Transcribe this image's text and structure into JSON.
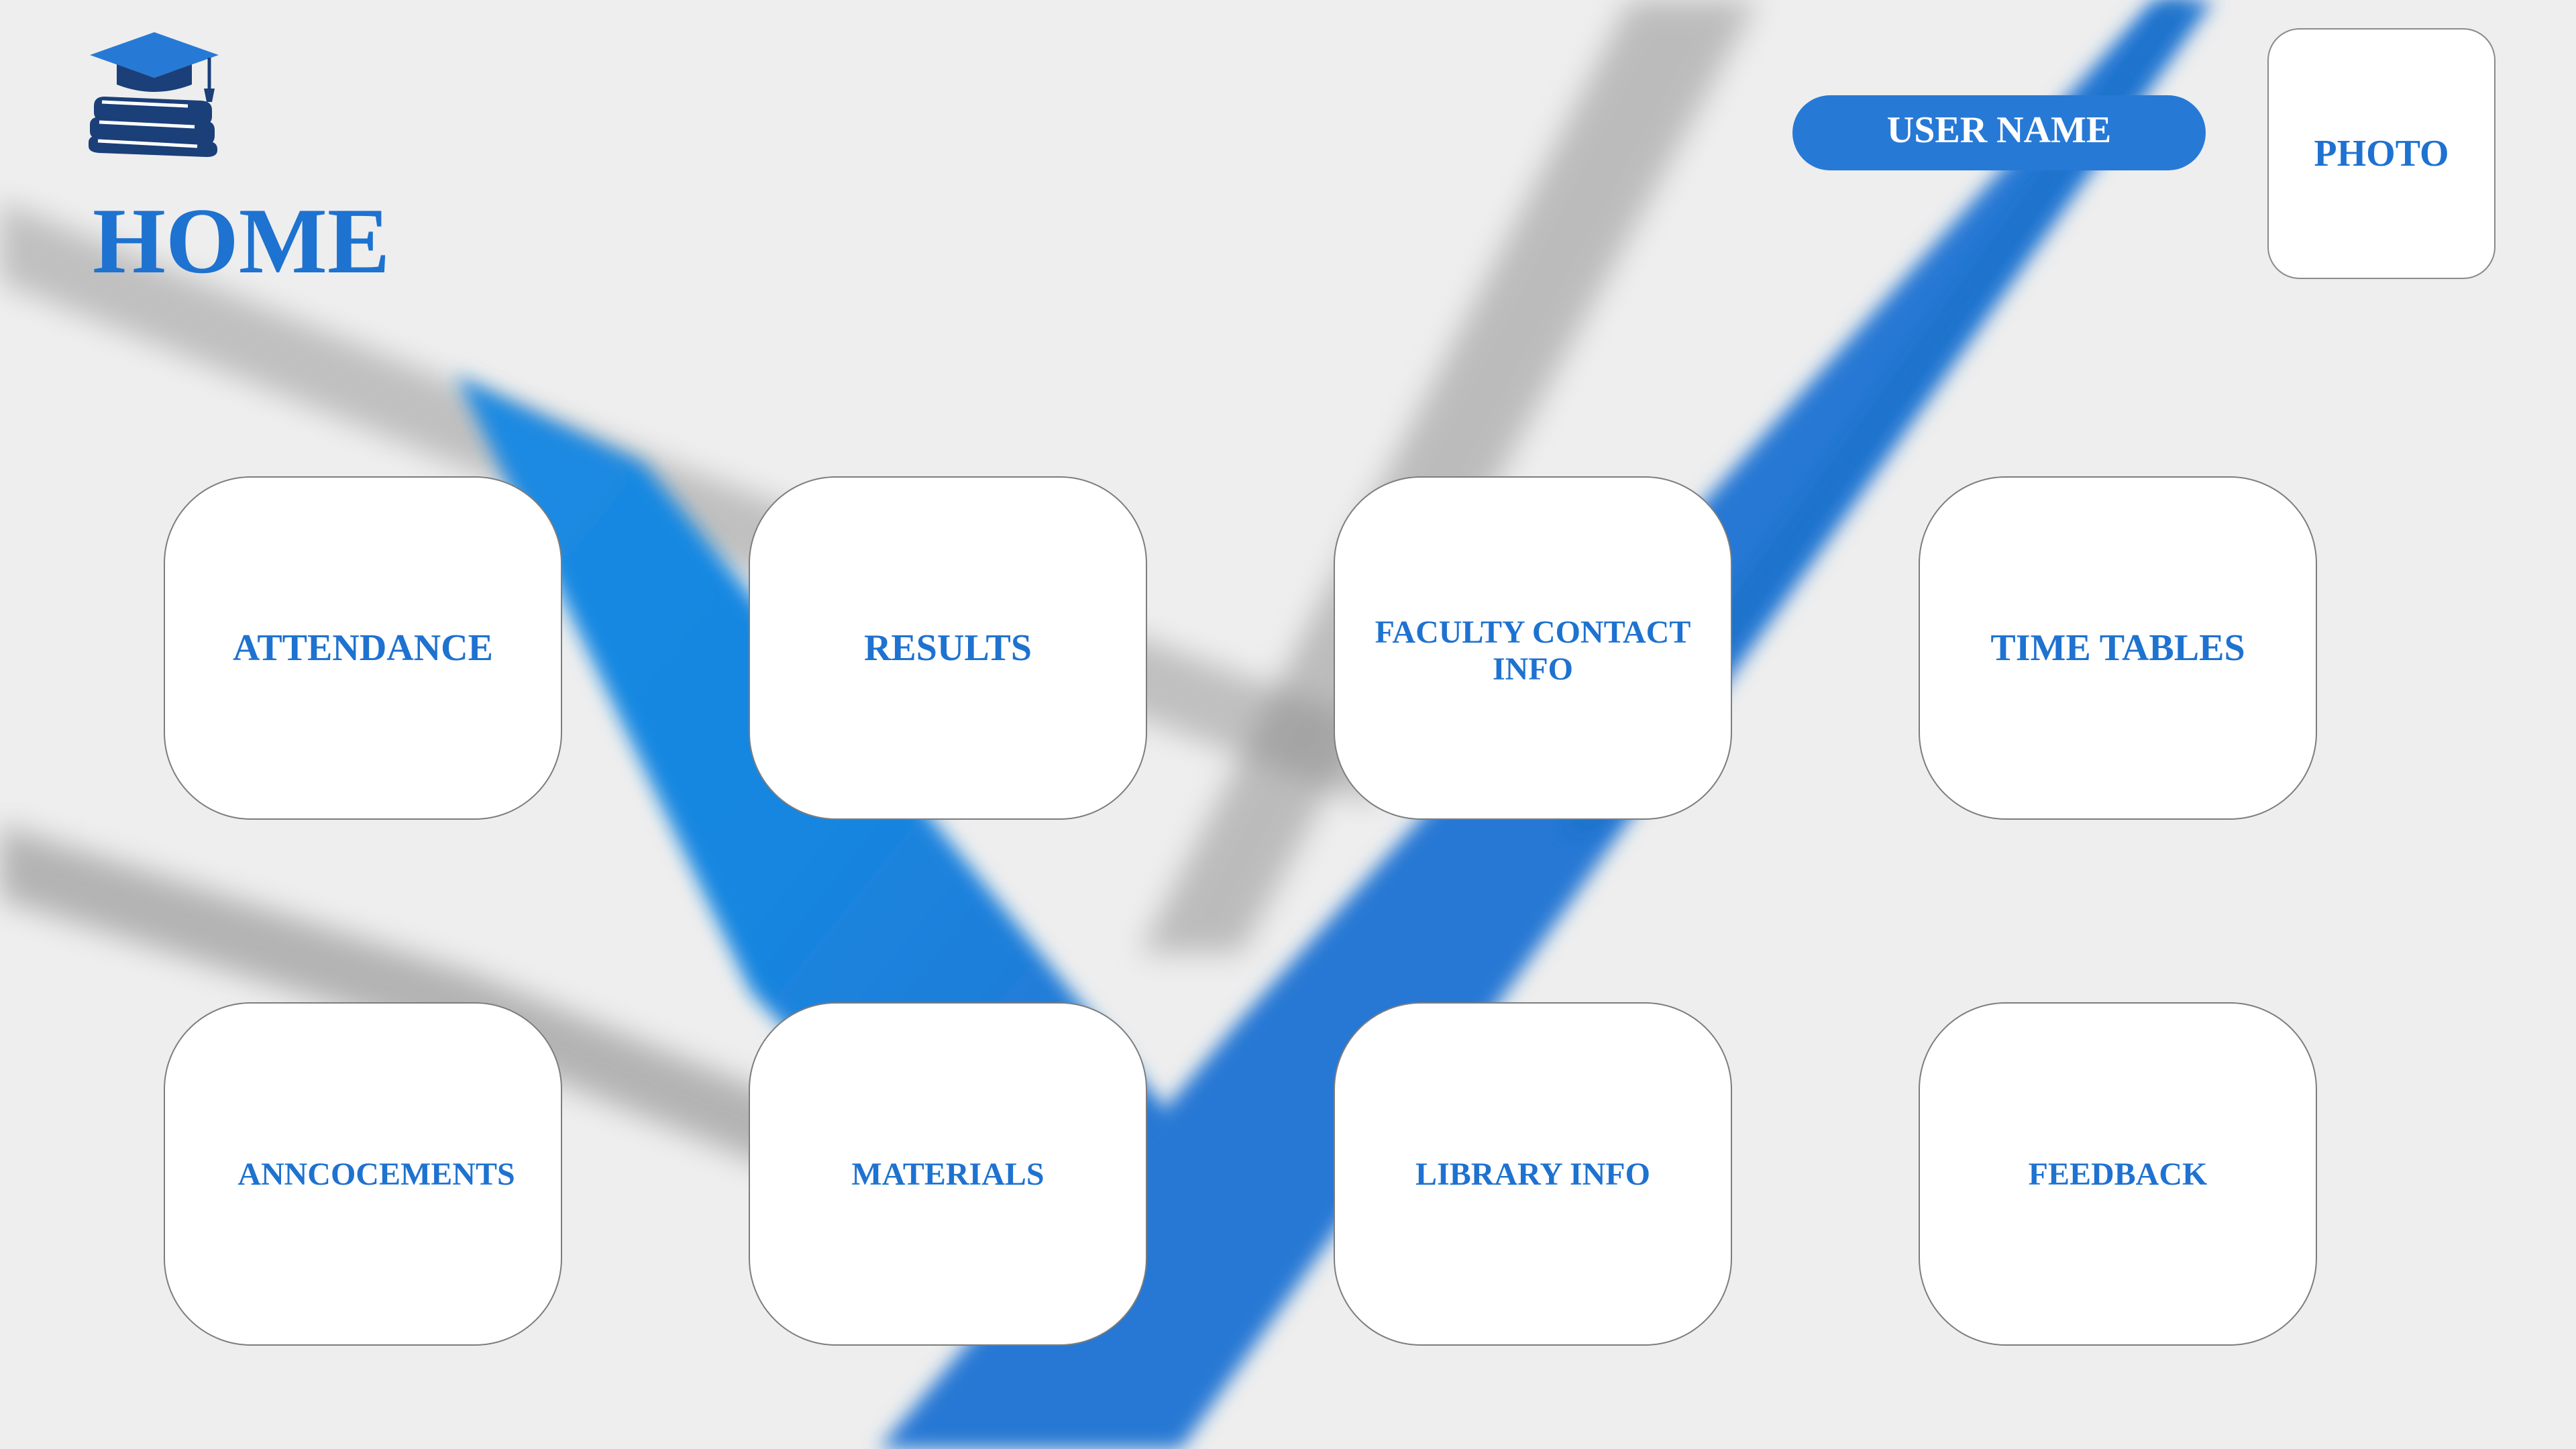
{
  "page": {
    "title": "HOME"
  },
  "header": {
    "logo_icon": "graduation-cap-books-icon",
    "user_name": "USER NAME",
    "photo_label": "PHOTO"
  },
  "menu": {
    "row1": [
      {
        "label": "ATTENDANCE",
        "icon": ""
      },
      {
        "label": "RESULTS"
      },
      {
        "label": "FACULTY CONTACT INFO"
      },
      {
        "label": "TIME TABLES"
      }
    ],
    "row2": [
      {
        "label": "ANNCOCEMENTS"
      },
      {
        "label": "MATERIALS"
      },
      {
        "label": "LIBRARY INFO"
      },
      {
        "label": "FEEDBACK"
      }
    ]
  },
  "colors": {
    "accent": "#1e72d0",
    "pill": "#2779d6",
    "background": "#eeeeee",
    "stripe": "#1a86e0",
    "logo": "#1b3f78"
  }
}
